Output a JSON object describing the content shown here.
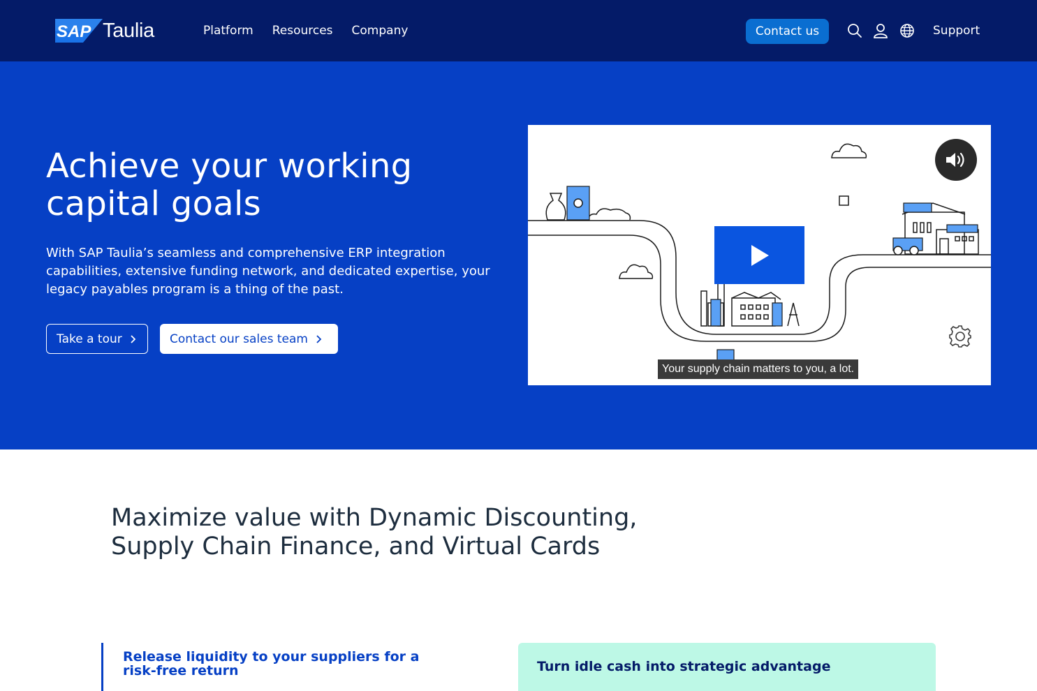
{
  "brand": {
    "logo_mark": "SAP",
    "logo_text": "Taulia"
  },
  "nav": {
    "links": [
      "Platform",
      "Resources",
      "Company"
    ],
    "contact_label": "Contact us",
    "support_label": "Support",
    "icons": [
      "search-icon",
      "user-icon",
      "globe-icon"
    ]
  },
  "hero": {
    "title": "Achieve your working capital goals",
    "description": "With SAP Taulia’s seamless and comprehensive ERP integration capabilities, extensive funding network, and dedicated expertise, your legacy payables program is a thing of the past.",
    "tour_label": "Take a tour",
    "sales_label": "Contact our sales team"
  },
  "video": {
    "caption": "Your supply chain matters to you, a lot.",
    "icons": [
      "play-icon",
      "volume-icon",
      "gear-icon"
    ]
  },
  "section": {
    "title": "Maximize value with Dynamic Discounting, Supply Chain Finance, and Virtual Cards"
  },
  "cards": {
    "left_title": "Release liquidity to your suppliers for a risk-free return",
    "right_title": "Turn idle cash into strategic advantage"
  },
  "colors": {
    "nav_bg": "#041b68",
    "hero_bg": "#0640c5",
    "accent": "#0a6ed1",
    "mint": "#bdf8e6"
  }
}
